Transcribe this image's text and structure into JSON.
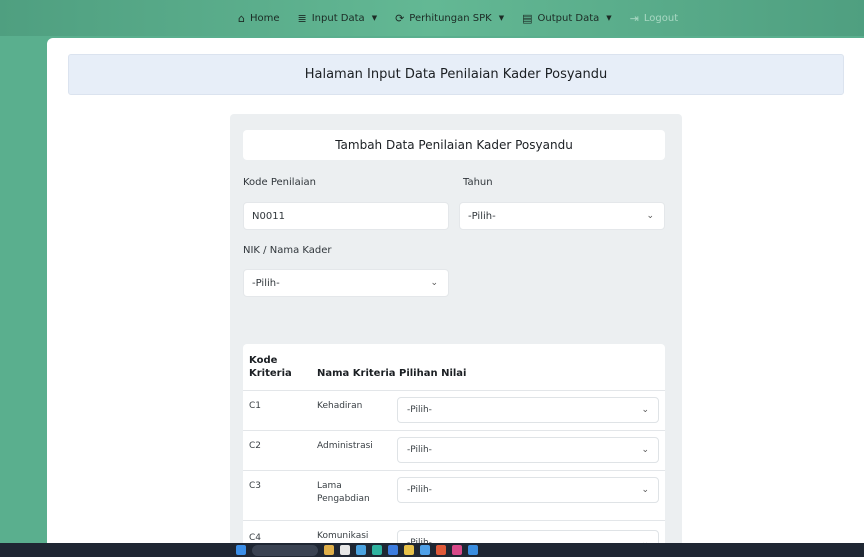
{
  "navbar": {
    "items": [
      {
        "icon": "home-icon",
        "glyph": "⌂",
        "label": "Home",
        "dropdown": false
      },
      {
        "icon": "database-icon",
        "glyph": "≣",
        "label": "Input Data",
        "dropdown": true
      },
      {
        "icon": "refresh-icon",
        "glyph": "⟳",
        "label": "Perhitungan SPK",
        "dropdown": true
      },
      {
        "icon": "file-icon",
        "glyph": "▤",
        "label": "Output Data",
        "dropdown": true
      },
      {
        "icon": "logout-icon",
        "glyph": "⇥",
        "label": "Logout",
        "dropdown": false
      }
    ],
    "caret": "▼"
  },
  "page": {
    "header": "Halaman Input Data Penilaian Kader Posyandu"
  },
  "form": {
    "title": "Tambah Data Penilaian Kader Posyandu",
    "kode_label": "Kode Penilaian",
    "kode_value": "N0011",
    "tahun_label": "Tahun",
    "tahun_value": "-Pilih-",
    "kader_label": "NIK / Nama Kader",
    "kader_value": "-Pilih-",
    "chevron": "⌄"
  },
  "table": {
    "headers": {
      "kode_line1": "Kode",
      "kode_line2": "Kriteria",
      "nama": "Nama Kriteria",
      "nilai": "Pilihan Nilai"
    },
    "rows": [
      {
        "kode": "C1",
        "nama": "Kehadiran",
        "nama2": "",
        "nilai": "-Pilih-"
      },
      {
        "kode": "C2",
        "nama": "Administrasi",
        "nama2": "",
        "nilai": "-Pilih-"
      },
      {
        "kode": "C3",
        "nama": "Lama",
        "nama2": "Pengabdian",
        "nilai": "-Pilih-"
      },
      {
        "kode": "C4",
        "nama": "Komunikasi",
        "nama2": "",
        "nilai": "-Pilih-"
      }
    ]
  },
  "colors": {
    "navbar_bg": "#5aaf8e",
    "header_bg": "#e7eef8",
    "card_bg": "#eceff1",
    "taskbar_bg": "#1f2733"
  }
}
